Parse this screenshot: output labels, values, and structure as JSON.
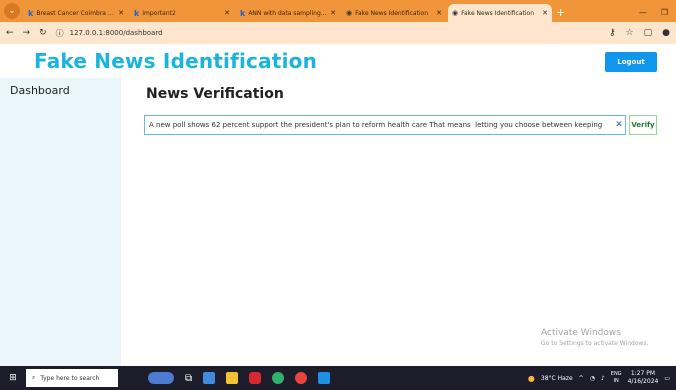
{
  "browser": {
    "tabs": [
      {
        "label": "Breast Cancer Coimbra Data",
        "favicon": "k",
        "active": false
      },
      {
        "label": "important2",
        "favicon": "k",
        "active": false
      },
      {
        "label": "ANN with data sampling · E",
        "favicon": "k",
        "active": false
      },
      {
        "label": "Fake News Identification",
        "favicon": "globe",
        "active": false
      },
      {
        "label": "Fake News Identification",
        "favicon": "globe",
        "active": true
      }
    ],
    "url": "127.0.0.1:8000/dashboard"
  },
  "header": {
    "brand": "Fake News Identification",
    "logout_label": "Logout"
  },
  "sidebar": {
    "title": "Dashboard"
  },
  "main": {
    "title": "News Verification",
    "news_input_value": "A new poll shows 62 percent support the president's plan to reform health care That means  letting you choose between keeping",
    "verify_label": "Verify"
  },
  "watermark": {
    "line1": "Activate Windows",
    "line2": "Go to Settings to activate Windows."
  },
  "taskbar": {
    "search_placeholder": "Type here to search",
    "weather": "38°C  Haze",
    "lang_line1": "ENG",
    "lang_line2": "IN",
    "time": "1:27 PM",
    "date": "4/16/2024"
  },
  "colors": {
    "tab_strip": "#f0953a",
    "brand": "#1bb4dc",
    "logout_bg": "#1196ee",
    "sidebar_bg": "#eaf5fc"
  }
}
